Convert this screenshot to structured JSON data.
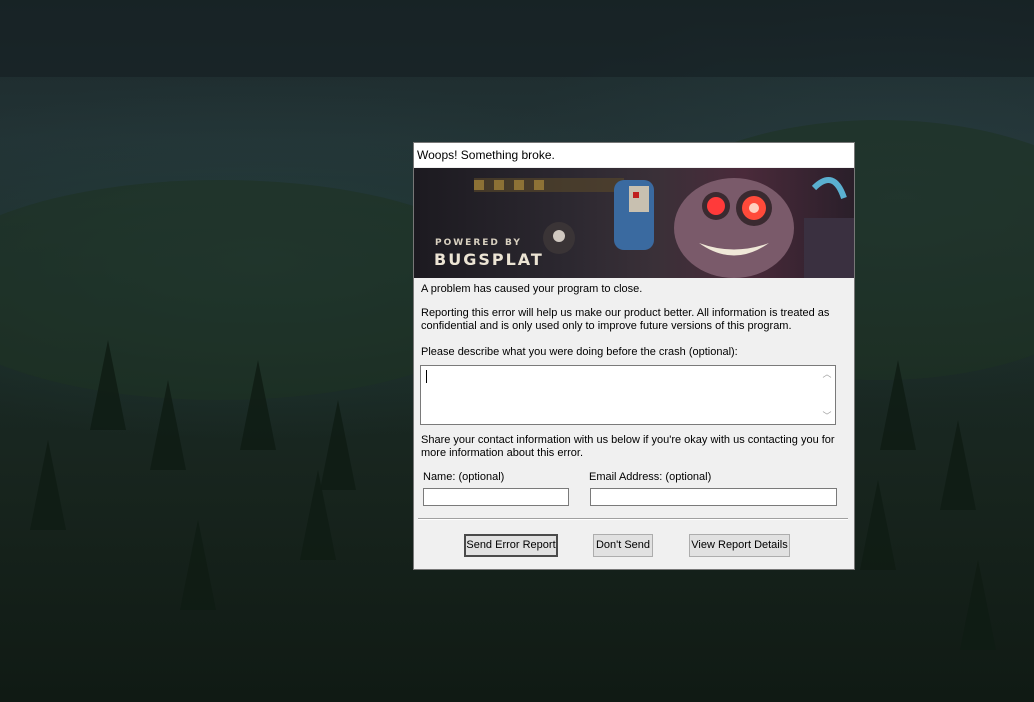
{
  "dialog": {
    "title": "Woops! Something broke.",
    "banner": {
      "powered_by": "POWERED BY",
      "brand": "BUGSPLAT"
    },
    "intro": "A problem has caused your program to close.",
    "reporting_note": "Reporting this error will help us make our product better. All information is treated as confidential and is only used only to improve future versions of this program.",
    "describe_label": "Please describe what you were doing before the crash (optional):",
    "describe_value": "",
    "contact_note": "Share your contact information with us below if you're okay with us contacting you for more information about this error.",
    "name_label": "Name: (optional)",
    "name_value": "",
    "email_label": "Email Address: (optional)",
    "email_value": "",
    "buttons": {
      "send": "Send Error Report",
      "dont_send": "Don't Send",
      "view_details": "View Report Details"
    }
  }
}
